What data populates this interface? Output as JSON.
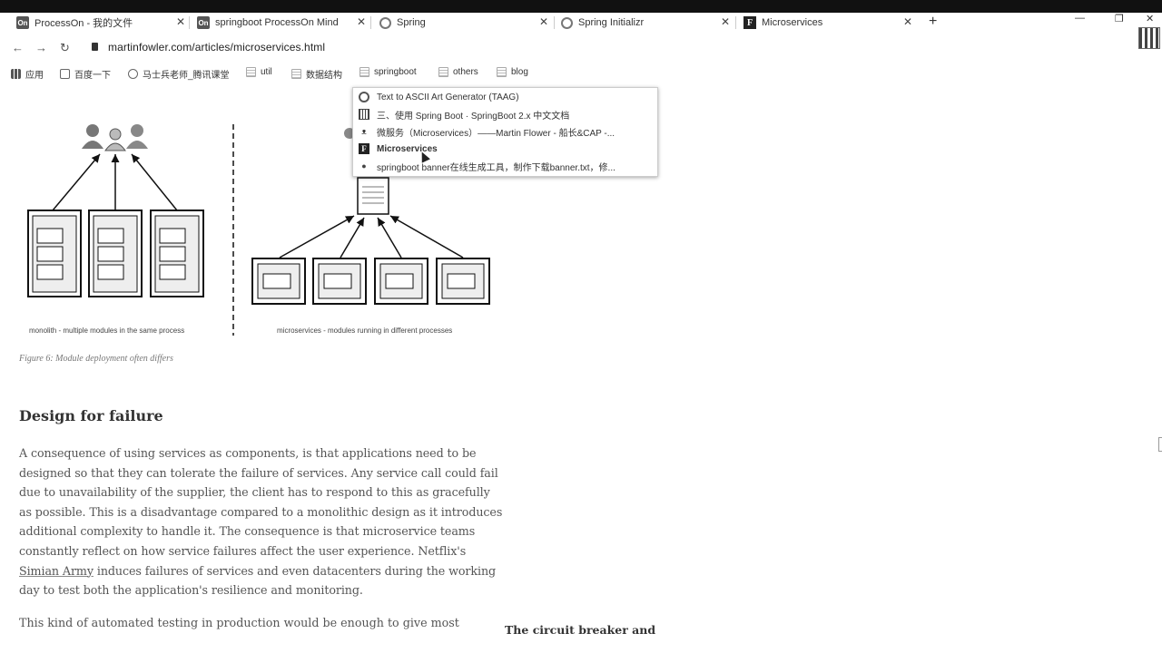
{
  "tabs": [
    {
      "title": "ProcessOn - 我的文件",
      "icon": "processon-icon"
    },
    {
      "title": "springboot ProcessOn Mind",
      "icon": "processon-icon"
    },
    {
      "title": "Spring",
      "icon": "spring-icon"
    },
    {
      "title": "Spring Initializr",
      "icon": "spring-icon"
    },
    {
      "title": "Microservices",
      "icon": "martinfowler-icon"
    }
  ],
  "window": {
    "minimize": "—",
    "restore": "❐",
    "close": "✕",
    "new_tab": "+"
  },
  "nav": {
    "back": "←",
    "forward": "→",
    "reload": "↻"
  },
  "address": {
    "url": "martinfowler.com/articles/microservices.html"
  },
  "bookmarks": [
    {
      "label": "应用"
    },
    {
      "label": "百度一下"
    },
    {
      "label": "马士兵老师_腾讯课堂"
    },
    {
      "label": "util"
    },
    {
      "label": "数据结构"
    },
    {
      "label": "springboot"
    },
    {
      "label": "others"
    },
    {
      "label": "blog"
    }
  ],
  "dropdown": {
    "items": [
      {
        "label": "Text to ASCII Art Generator (TAAG)",
        "icon": "globe-icon"
      },
      {
        "label": "三、使用 Spring Boot · SpringBoot 2.x 中文文档",
        "icon": "book-icon"
      },
      {
        "label": "微服务（Microservices）——Martin Flower - 船长&CAP -...",
        "icon": "user-icon"
      },
      {
        "label": "Microservices",
        "icon": "martinfowler-icon"
      },
      {
        "label": "springboot banner在线生成工具，制作下载banner.txt，修...",
        "icon": "leaf-icon"
      }
    ]
  },
  "figure": {
    "left_caption": "monolith - multiple modules in the same process",
    "right_caption": "microservices - modules running in different processes",
    "caption": "Figure 6: Module deployment often differs"
  },
  "article": {
    "heading": "Design for failure",
    "para1_a": "A consequence of using services as components, is that applications need to be designed so that they can tolerate the failure of services. Any service call could fail due to unavailability of the supplier, the client has to respond to this as gracefully as possible. This is a disadvantage compared to a monolithic design as it introduces additional complexity to handle it. The consequence is that microservice teams constantly reflect on how service failures affect the user experience. Netflix's ",
    "para1_link": "Simian Army",
    "para1_b": " induces failures of services and even datacenters during the working day to test both the application's resilience and monitoring.",
    "para2": "This kind of automated testing in production would be enough to give most",
    "sidebar_title": "The circuit breaker and"
  }
}
